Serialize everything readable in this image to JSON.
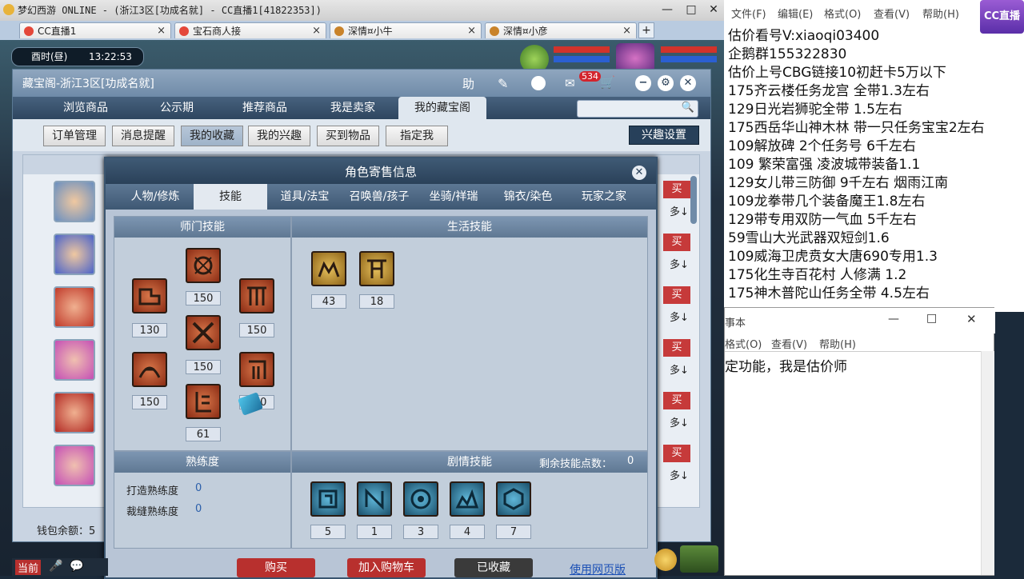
{
  "window": {
    "title": "梦幻西游 ONLINE - (浙江3区[功成名就] - CC直播1[41822353])",
    "controls": {
      "minimize": "—",
      "maximize": "□",
      "close": "✕"
    }
  },
  "browser_tabs": [
    {
      "label": "CC直播1",
      "close": "×"
    },
    {
      "label": "宝石商人接",
      "close": "×"
    },
    {
      "label": "深情¤小牛",
      "close": "×"
    },
    {
      "label": "深情¤小彦",
      "close": "×"
    }
  ],
  "new_tab": "+",
  "game_clock": {
    "period": "酉时(昼)",
    "time": "13:22:53"
  },
  "treasure_pavilion": {
    "title": "藏宝阁-浙江3区[功成名就]",
    "header_icons": {
      "help": "助",
      "badge_count": "534"
    },
    "nav_tabs": [
      "浏览商品",
      "公示期",
      "推荐商品",
      "我是卖家",
      "我的藏宝阁"
    ],
    "active_nav": "我的藏宝阁",
    "sub_buttons": [
      "订单管理",
      "消息提醒",
      "我的收藏",
      "我的兴趣",
      "买到物品",
      "指定我"
    ],
    "active_sub": "我的收藏",
    "interest_settings": "兴趣设置",
    "list_buy_labels": [
      "买",
      "买",
      "买",
      "买",
      "买",
      "买"
    ],
    "list_arrow_labels": [
      "多↓",
      "多↓",
      "多↓",
      "多↓",
      "多↓",
      "多↓"
    ],
    "wallet_label": "钱包余额：5"
  },
  "dialog": {
    "title": "角色寄售信息",
    "close": "✕",
    "tabs": [
      "人物/修炼",
      "技能",
      "道具/法宝",
      "召唤兽/孩子",
      "坐骑/祥瑞",
      "锦衣/染色",
      "玩家之家"
    ],
    "active_tab": "技能",
    "school_skills": {
      "heading": "师门技能",
      "levels": [
        "130",
        "150",
        "150",
        "150",
        "150",
        "150",
        "61"
      ]
    },
    "life_skills": {
      "heading": "生活技能",
      "levels": [
        "43",
        "18"
      ]
    },
    "proficiency": {
      "heading": "熟练度",
      "items": [
        {
          "label": "打造熟练度",
          "value": "0"
        },
        {
          "label": "裁缝熟练度",
          "value": "0"
        }
      ]
    },
    "story_skills": {
      "heading": "剧情技能",
      "remaining_label": "剩余技能点数：",
      "remaining_value": "0",
      "levels": [
        "5",
        "1",
        "3",
        "4",
        "7"
      ]
    },
    "actions": {
      "buy": "购买",
      "add_cart": "加入购物车",
      "favorited": "已收藏",
      "web_version": "使用网页版"
    }
  },
  "bottom_bar": {
    "label": "当前"
  },
  "notepad_main": {
    "menu": [
      "文件(F)",
      "编辑(E)",
      "格式(O)",
      "查看(V)",
      "帮助(H)"
    ],
    "lines": [
      "估价看号V:xiaoqi03400",
      "企鹅群155322830",
      "估价上号CBG链接10初赶卡5万以下",
      "175齐云楼任务龙宫 全带1.3左右",
      "129日光岩狮驼全带 1.5左右",
      "175西岳华山神木林 带一只任务宝宝2左右",
      "109解放碑 2个任务号 6千左右",
      "109 繁荣富强 凌波城带装备1.1",
      "129女儿带三防御 9千左右 烟雨江南",
      "109龙拳带几个装备魔王1.8左右",
      "129带专用双防一气血 5千左右",
      "59雪山大光武器双短剑1.6",
      "109威海卫虎贲女大唐690专用1.3",
      "175化生寺百花村 人修满 1.2",
      "175神木普陀山任务全带 4.5左右"
    ]
  },
  "cc_logo": "CC直播",
  "notepad_small": {
    "title": "事本",
    "menu": [
      "格式(O)",
      "查看(V)",
      "帮助(H)"
    ],
    "body": "定功能，我是估价师"
  }
}
